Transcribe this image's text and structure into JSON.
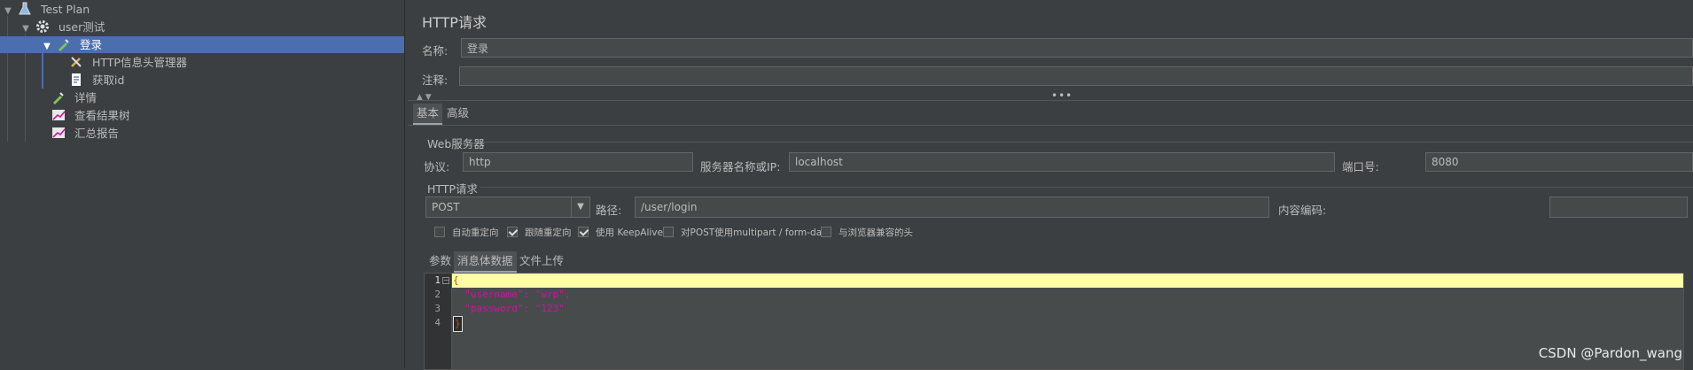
{
  "tree": {
    "items": [
      {
        "label": "Test Plan",
        "icon": "flask-icon",
        "expanded": true
      },
      {
        "label": "user测试",
        "icon": "gear-icon",
        "expanded": true
      },
      {
        "label": "登录",
        "icon": "pipette-icon",
        "expanded": true,
        "selected": true
      },
      {
        "label": "HTTP信息头管理器",
        "icon": "wrench-icon"
      },
      {
        "label": "获取id",
        "icon": "script-icon"
      },
      {
        "label": "详情",
        "icon": "pipette-icon"
      },
      {
        "label": "查看结果树",
        "icon": "chart-icon"
      },
      {
        "label": "汇总报告",
        "icon": "chart-icon"
      }
    ]
  },
  "panel": {
    "title": "HTTP请求",
    "name_label": "名称:",
    "name_value": "登录",
    "comment_label": "注释:",
    "comment_value": "",
    "tabs": [
      "基本",
      "高级"
    ],
    "active_tab": "基本",
    "web_server_section": "Web服务器",
    "protocol_label": "协议:",
    "protocol_value": "http",
    "server_label": "服务器名称或IP:",
    "server_value": "localhost",
    "port_label": "端口号:",
    "port_value": "8080",
    "http_section": "HTTP请求",
    "method_value": "POST",
    "path_label": "路径:",
    "path_value": "/user/login",
    "encoding_label": "内容编码:",
    "encoding_value": "",
    "options": [
      {
        "label": "自动重定向",
        "checked": false
      },
      {
        "label": "跟随重定向",
        "checked": true
      },
      {
        "label": "使用 KeepAlive",
        "checked": true
      },
      {
        "label": "对POST使用multipart / form-data",
        "checked": false
      },
      {
        "label": "与浏览器兼容的头",
        "checked": false
      }
    ],
    "body_tabs": [
      "参数",
      "消息体数据",
      "文件上传"
    ],
    "active_body_tab": "消息体数据"
  },
  "editor": {
    "line_numbers": [
      "1",
      "2",
      "3",
      "4"
    ],
    "lines": [
      "{",
      "  \"username\": \"wrp\",",
      "  \"password\": \"123\"",
      "}"
    ]
  },
  "watermark": "CSDN @Pardon_wang",
  "colors": {
    "background": "#3c3f41",
    "selection": "#4b6eaf",
    "json_key": "#c7179b",
    "current_line": "#ffffa8"
  }
}
